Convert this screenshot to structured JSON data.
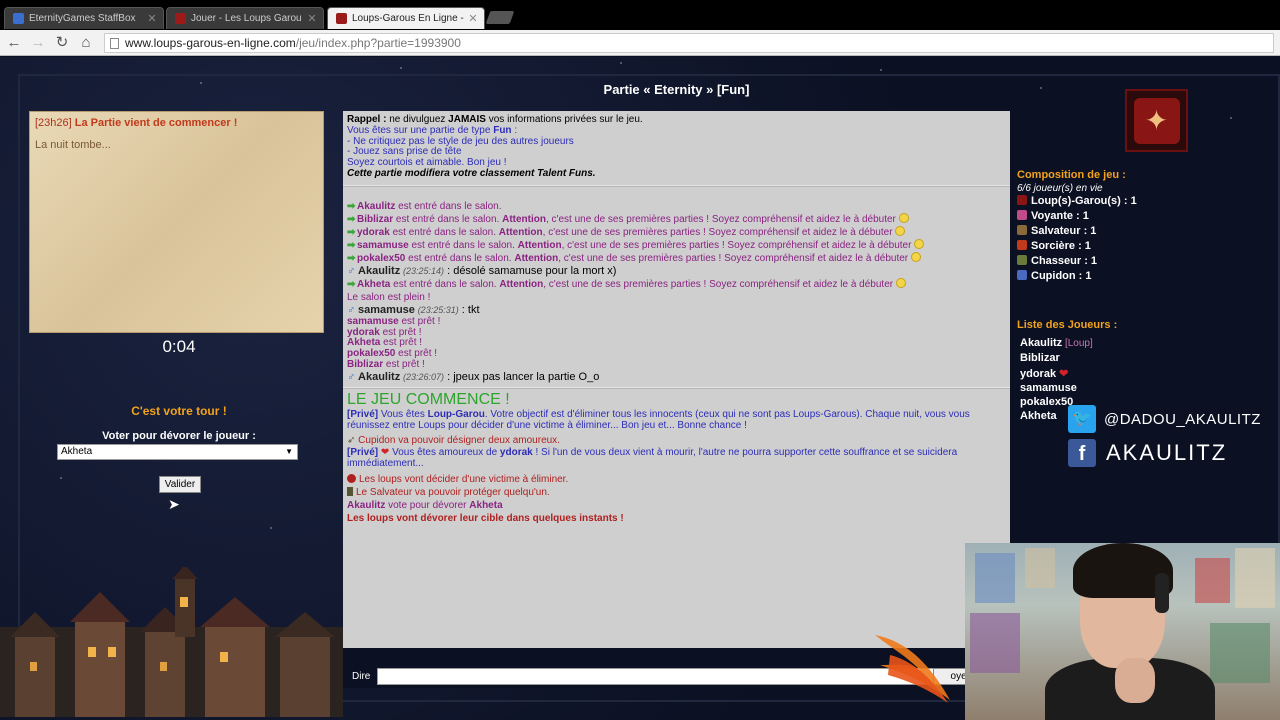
{
  "browser": {
    "tabs": [
      {
        "title": "EternityGames StaffBox",
        "favicon_color": "#3a6fd1",
        "active": false
      },
      {
        "title": "Jouer - Les Loups Garou",
        "favicon_color": "#9b1b1b",
        "active": false
      },
      {
        "title": "Loups-Garous En Ligne - J",
        "favicon_color": "#9b1b1b",
        "active": true
      }
    ],
    "close_glyph": "✕",
    "url_host": "www.loups-garous-en-ligne.com",
    "url_path": "/jeu/index.php?partie=1993900"
  },
  "game": {
    "title": "Partie « Eternity » [Fun]",
    "narration": {
      "time": "[23h26]",
      "headline": "La Partie vient de commencer !",
      "text": "La nuit tombe..."
    },
    "timer": "0:04",
    "your_turn": "C'est votre tour !",
    "vote_label": "Voter pour dévorer le joueur :",
    "vote_selected": "Akheta",
    "validate_label": "Valider",
    "say_label": "Dire",
    "send_label": "oyer"
  },
  "rules": {
    "reminder_bold": "Rappel :",
    "reminder_a": " ne divulguez ",
    "reminder_jamais": "JAMAIS",
    "reminder_b": " vos informations privées sur le jeu.",
    "type_line_a": "Vous êtes sur une partie de type ",
    "type_line_fun": "Fun",
    "type_line_b": " :",
    "rule1": "- Ne critiquez pas le style de jeu des autres joueurs",
    "rule2": "- Jouez sans prise de tête",
    "rule3": "Soyez courtois et aimable. Bon jeu !",
    "ranking": "Cette partie modifiera votre classement Talent Funs."
  },
  "chat": {
    "entered": " est entré dans le salon.",
    "entered_warn": " est entré dans le salon. ",
    "attention": "Attention",
    "warn_text": ", c'est une de ses premières parties ! Soyez compréhensif et aidez le à débuter",
    "p_akaulitz": "Akaulitz",
    "p_biblizar": "Biblizar",
    "p_ydorak": "ydorak",
    "p_samamuse": "samamuse",
    "p_pokalex50": "pokalex50",
    "p_akheta": "Akheta",
    "msg1_time": "(23:25:14)",
    "msg1_text": " : désolé samamuse pour la mort x)",
    "salon_full": "Le salon est plein !",
    "msg2_time": "(23:25:31)",
    "msg2_text": " : tkt",
    "ready": " est prêt !",
    "msg3_time": "(23:26:07)",
    "msg3_text": " : jpeux pas lancer la partie O_o",
    "game_start": "LE JEU COMMENCE !",
    "prive": "[Privé]",
    "role_a": " Vous êtes ",
    "role_name": "Loup-Garou",
    "role_b": ". Votre objectif est d'éliminer tous les innocents (ceux qui ne sont pas Loups-Garous). Chaque nuit, vous vous réunissez entre Loups pour décider d'une victime à éliminer... Bon jeu et... Bonne chance !",
    "cupidon": "Cupidon va pouvoir désigner deux amoureux.",
    "lovers_a": " Vous êtes amoureux de ",
    "lovers_b": " ! Si l'un de vous deux vient à mourir, l'autre ne pourra supporter cette souffrance et se suicidera immédiatement...",
    "wolves_decide": "Les loups vont décider d'une victime à éliminer.",
    "salvateur": "Le Salvateur va pouvoir protéger quelqu'un.",
    "vote_text": " vote pour dévorer ",
    "wolves_soon": "Les loups vont dévorer leur cible dans quelques instants !"
  },
  "composition": {
    "title": "Composition de jeu :",
    "alive": "6/6 joueur(s) en vie",
    "roles": [
      {
        "name": "Loup(s)-Garou(s)",
        "count": " : 1",
        "color": "#8a1515"
      },
      {
        "name": "Voyante",
        "count": " : 1",
        "color": "#c04a8a"
      },
      {
        "name": "Salvateur",
        "count": " : 1",
        "color": "#8a6a3a"
      },
      {
        "name": "Sorcière",
        "count": " : 1",
        "color": "#c23a1c"
      },
      {
        "name": "Chasseur",
        "count": " : 1",
        "color": "#6a7a3a"
      },
      {
        "name": "Cupidon",
        "count": " : 1",
        "color": "#4a6ac2"
      }
    ]
  },
  "players": {
    "title": "Liste des Joueurs :",
    "list": [
      "Akaulitz",
      "Biblizar",
      "ydorak",
      "samamuse",
      "pokalex50",
      "Akheta"
    ],
    "wolf_tag": " [Loup]"
  },
  "overlay": {
    "twitter": "@DADOU_AKAULITZ",
    "facebook": "AKAULITZ",
    "fb_glyph": "f",
    "tw_glyph": "🐦",
    "twitter_color": "#2aa3ef",
    "facebook_color": "#3b5998"
  },
  "colors": {
    "accent_orange": "#f2a31b",
    "player_purple": "#8a2382",
    "chat_blue": "#2d2db8",
    "start_green": "#2da52d",
    "alert_red": "#b02020"
  }
}
